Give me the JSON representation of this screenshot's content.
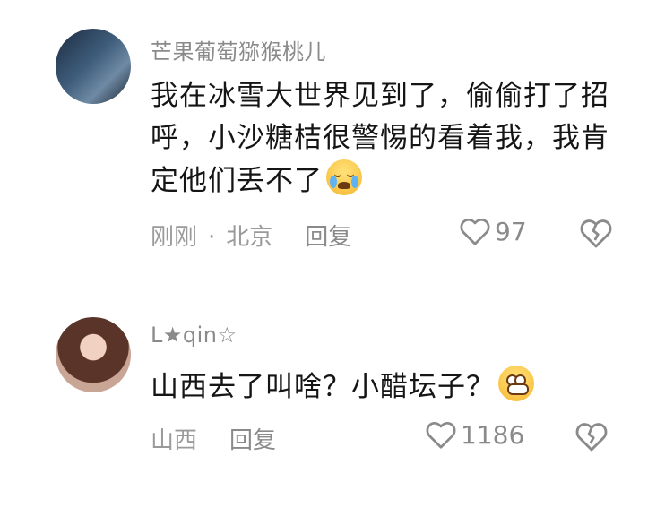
{
  "comments": [
    {
      "username": "芒果葡萄猕猴桃儿",
      "content": "我在冰雪大世界见到了，偷偷打了招呼，小沙糖桔很警惕的看着我，我肯定他们丢不了",
      "emoji": "loudly-crying-face",
      "time": "刚刚",
      "location": "北京",
      "reply_label": "回复",
      "likes": "97"
    },
    {
      "username": "L★qin☆",
      "content": "山西去了叫啥？小醋坛子？",
      "emoji": "grinning-face",
      "location": "山西",
      "reply_label": "回复",
      "likes": "1186"
    }
  ],
  "colors": {
    "text": "#151515",
    "meta": "#9a9a9a",
    "background": "#ffffff"
  }
}
